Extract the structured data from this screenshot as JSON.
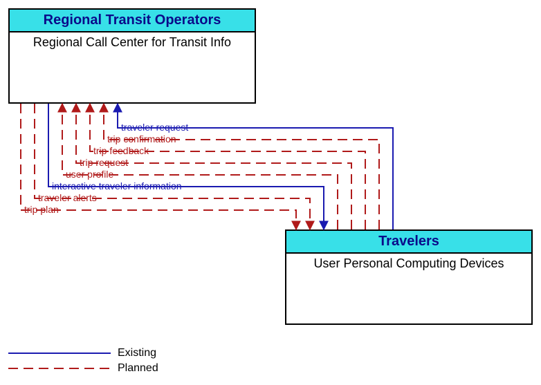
{
  "source_box": {
    "header": "Regional Transit Operators",
    "sub": "Regional Call Center for Transit Info"
  },
  "dest_box": {
    "header": "Travelers",
    "sub": "User Personal Computing Devices"
  },
  "flows": {
    "traveler_request": "traveler request",
    "trip_confirmation": "trip confirmation",
    "trip_feedback": "trip feedback",
    "trip_request": "trip request",
    "user_profile": "user profile",
    "interactive_traveler_information": "interactive traveler information",
    "traveler_alerts": "traveler alerts",
    "trip_plan": "trip plan"
  },
  "legend": {
    "existing": "Existing",
    "planned": "Planned"
  }
}
